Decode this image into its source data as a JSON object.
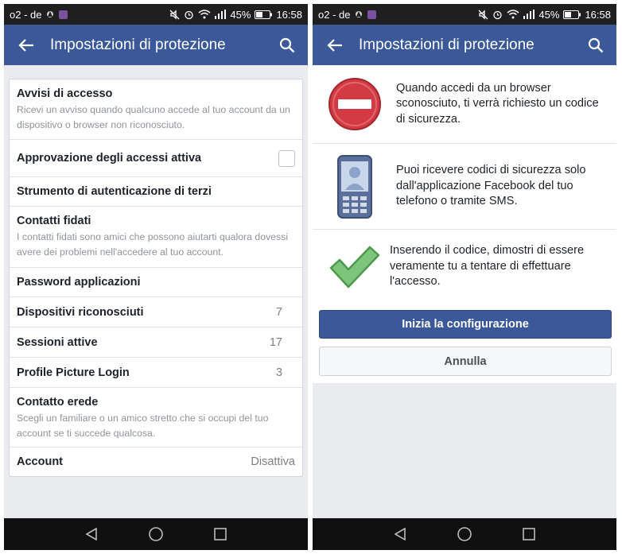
{
  "status_bar": {
    "carrier": "o2 - de",
    "battery": "45%",
    "time": "16:58"
  },
  "app_bar": {
    "title": "Impostazioni di protezione"
  },
  "settings": {
    "login_alerts": {
      "title": "Avvisi di accesso",
      "description": "Ricevi un avviso quando qualcuno accede al tuo account da un dispositivo o browser non riconosciuto."
    },
    "login_approvals": {
      "title": "Approvazione degli accessi attiva",
      "checked": false
    },
    "code_generator": {
      "title": "Strumento di autenticazione di terzi"
    },
    "trusted_contacts": {
      "title": "Contatti fidati",
      "description": "I contatti fidati sono amici che possono aiutarti qualora dovessi avere dei problemi nell'accedere al tuo account."
    },
    "app_passwords": {
      "title": "Password applicazioni"
    },
    "recognized_devices": {
      "title": "Dispositivi riconosciuti",
      "value": "7"
    },
    "active_sessions": {
      "title": "Sessioni attive",
      "value": "17"
    },
    "profile_picture_login": {
      "title": "Profile Picture Login",
      "value": "3"
    },
    "legacy_contact": {
      "title": "Contatto erede",
      "description": "Scegli un familiare o un amico stretto che si occupi del tuo account se ti succede qualcosa."
    },
    "account": {
      "title": "Account",
      "value": "Disattiva"
    }
  },
  "setup": {
    "step1": "Quando accedi da un browser sconosciuto, ti verrà richiesto un codice di sicurezza.",
    "step2": "Puoi ricevere codici di sicurezza solo dall'applicazione Facebook del tuo telefono o tramite SMS.",
    "step3": "Inserendo il codice, dimostri di essere veramente tu a tentare di effettuare l'accesso.",
    "start_button": "Inizia la configurazione",
    "cancel_button": "Annulla"
  },
  "colors": {
    "facebook_blue": "#3b5998",
    "status_bar": "#1f1f1f",
    "nav_bar": "#101010",
    "background": "#e9ebee",
    "stop_red": "#d23b43",
    "check_green": "#5cb85c"
  },
  "icons": [
    "back-arrow-icon",
    "search-icon",
    "mute-icon",
    "alarm-icon",
    "wifi-icon",
    "signal-icon",
    "battery-icon",
    "stop-sign-icon",
    "phone-icon",
    "checkmark-icon",
    "nav-back-icon",
    "nav-home-icon",
    "nav-recents-icon"
  ]
}
